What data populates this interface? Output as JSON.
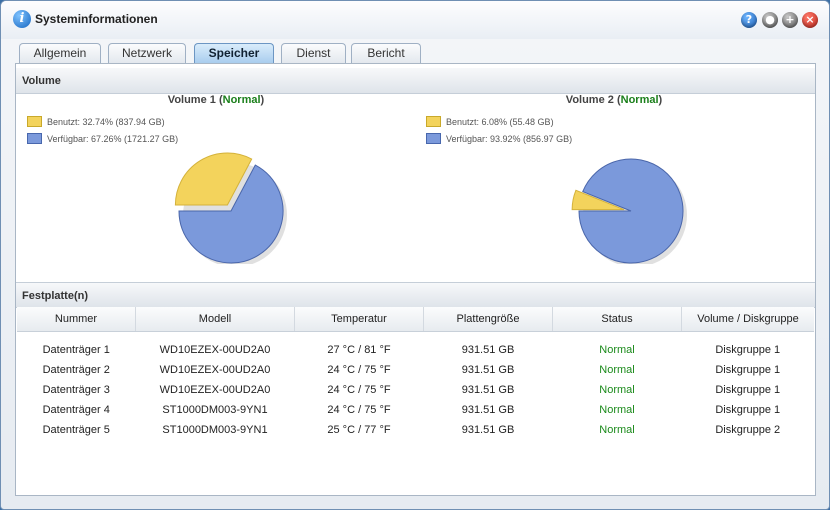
{
  "window": {
    "title": "Systeminformationen"
  },
  "tabs": [
    {
      "label": "Allgemein"
    },
    {
      "label": "Netzwerk"
    },
    {
      "label": "Speicher"
    },
    {
      "label": "Dienst"
    },
    {
      "label": "Bericht"
    }
  ],
  "active_tab": "Speicher",
  "colors": {
    "used": "#f3d35c",
    "free": "#7b99db",
    "status_ok": "#1a8a1a"
  },
  "volume_section": {
    "title": "Volume",
    "volumes": [
      {
        "name": "Volume 1",
        "status": "Normal",
        "used_label": "Benutzt: 32.74% (837.94 GB)",
        "free_label": "Verfügbar: 67.26% (1721.27 GB)",
        "used_pct": 32.74,
        "free_pct": 67.26
      },
      {
        "name": "Volume 2",
        "status": "Normal",
        "used_label": "Benutzt: 6.08% (55.48 GB)",
        "free_label": "Verfügbar: 93.92% (856.97 GB)",
        "used_pct": 6.08,
        "free_pct": 93.92
      }
    ]
  },
  "disk_section": {
    "title": "Festplatte(n)",
    "columns": [
      "Nummer",
      "Modell",
      "Temperatur",
      "Plattengröße",
      "Status",
      "Volume / Diskgruppe"
    ],
    "rows": [
      [
        "Datenträger 1",
        "WD10EZEX-00UD2A0",
        "27 °C / 81 °F",
        "931.51 GB",
        "Normal",
        "Diskgruppe 1"
      ],
      [
        "Datenträger 2",
        "WD10EZEX-00UD2A0",
        "24 °C / 75 °F",
        "931.51 GB",
        "Normal",
        "Diskgruppe 1"
      ],
      [
        "Datenträger 3",
        "WD10EZEX-00UD2A0",
        "24 °C / 75 °F",
        "931.51 GB",
        "Normal",
        "Diskgruppe 1"
      ],
      [
        "Datenträger 4",
        "ST1000DM003-9YN1",
        "24 °C / 75 °F",
        "931.51 GB",
        "Normal",
        "Diskgruppe 1"
      ],
      [
        "Datenträger 5",
        "ST1000DM003-9YN1",
        "25 °C / 77 °F",
        "931.51 GB",
        "Normal",
        "Diskgruppe 2"
      ]
    ]
  }
}
